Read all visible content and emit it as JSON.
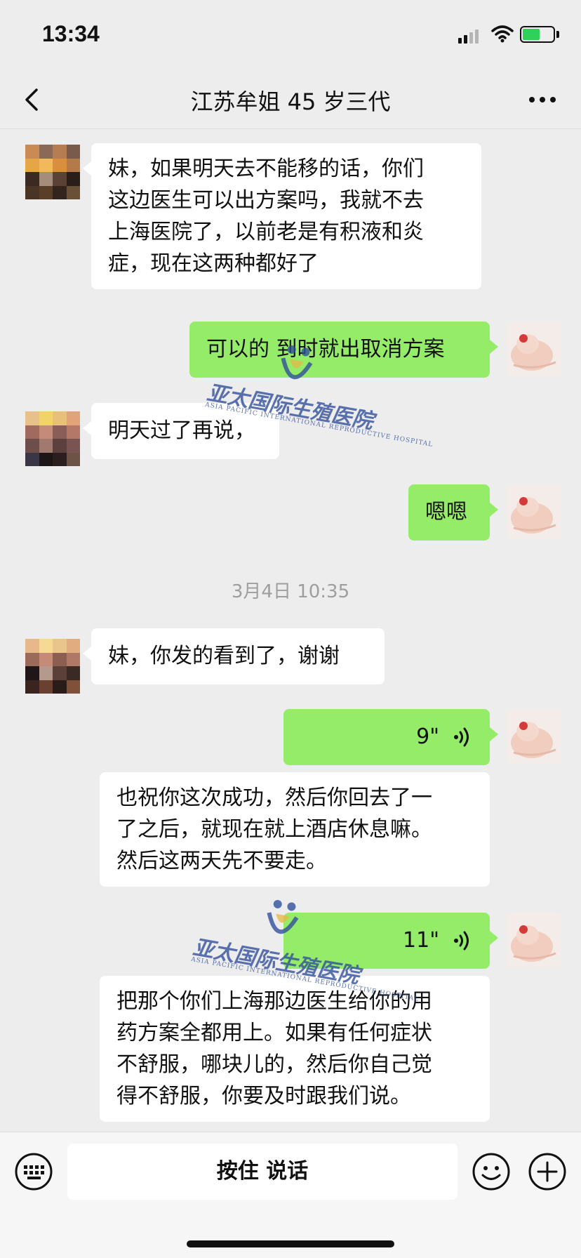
{
  "status_bar": {
    "time": "13:34"
  },
  "header": {
    "title": "江苏牟姐 45 岁三代"
  },
  "messages": {
    "m1": {
      "lines": [
        "妹，如果明天去不能移的话，你们",
        "这边医生可以出方案吗，我就不去",
        "上海医院了，以前老是有积液和炎",
        "症，现在这两种都好了"
      ]
    },
    "m2": {
      "text": "可以的 到时就出取消方案"
    },
    "m3": {
      "text": "明天过了再说，"
    },
    "m4": {
      "text": "嗯嗯"
    },
    "timestamp": "3月4日 10:35",
    "m5": {
      "text": "妹，你发的看到了，谢谢"
    },
    "m6": {
      "duration": "9\""
    },
    "m6_transcript": {
      "lines": [
        "也祝你这次成功，然后你回去了一",
        "了之后，就现在就上酒店休息嘛。",
        "然后这两天先不要走。"
      ]
    },
    "m7": {
      "duration": "11\""
    },
    "m7_transcript": {
      "lines": [
        "把那个你们上海那边医生给你的用",
        "药方案全都用上。如果有任何症状",
        "不舒服，哪块儿的，然后你自己觉",
        "得不舒服，你要及时跟我们说。"
      ]
    }
  },
  "watermark": {
    "name": "亚太国际生殖医院",
    "subtitle": "ASIA PACIFIC INTERNATIONAL REPRODUCTIVE HOSPITAL"
  },
  "input_bar": {
    "hold_to_talk": "按住 说话"
  },
  "icons": {
    "back": "chevron-left-icon",
    "more": "more-dots-icon",
    "keyboard": "keyboard-icon",
    "emoji": "emoji-icon",
    "add": "plus-icon",
    "voice": "voice-wave-icon"
  },
  "colors": {
    "background": "#ededed",
    "sent_bubble": "#95ec69",
    "received_bubble": "#ffffff",
    "watermark": "#2f4c9c"
  }
}
